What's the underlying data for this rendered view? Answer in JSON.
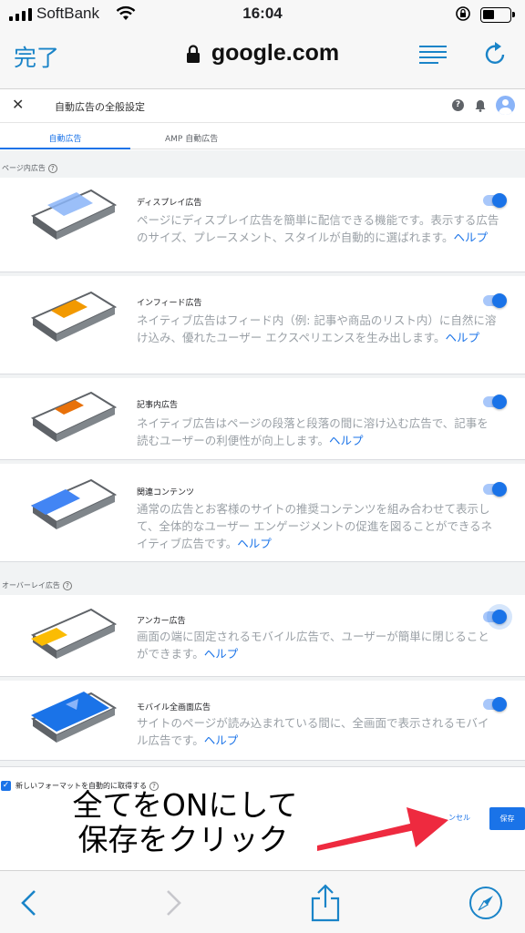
{
  "status_bar": {
    "carrier": "SoftBank",
    "time": "16:04"
  },
  "safari": {
    "done_label": "完了",
    "url": "google.com"
  },
  "header": {
    "title": "自動広告の全般設定"
  },
  "tabs": [
    {
      "label": "自動広告",
      "active": true
    },
    {
      "label": "AMP 自動広告",
      "active": false
    }
  ],
  "sections": {
    "in_page": "ページ内広告",
    "overlay": "オーバーレイ広告"
  },
  "formats": [
    {
      "title": "ディスプレイ広告",
      "description": "ページにディスプレイ広告を簡単に配信できる機能です。表示する広告のサイズ、プレースメント、スタイルが自動的に選ばれます。",
      "help": "ヘルプ",
      "enabled": true,
      "illustration_color": "#8ab4f8"
    },
    {
      "title": "インフィード広告",
      "description": "ネイティブ広告はフィード内（例: 記事や商品のリスト内）に自然に溶け込み、優れたユーザー エクスペリエンスを生み出します。",
      "help": "ヘルプ",
      "enabled": true,
      "illustration_color": "#f29900"
    },
    {
      "title": "記事内広告",
      "description": "ネイティブ広告はページの段落と段落の間に溶け込む広告で、記事を読むユーザーの利便性が向上します。",
      "help": "ヘルプ",
      "enabled": true,
      "illustration_color": "#e8710a"
    },
    {
      "title": "関連コンテンツ",
      "description": "通常の広告とお客様のサイトの推奨コンテンツを組み合わせて表示して、全体的なユーザー エンゲージメントの促進を図ることができるネイティブ広告です。",
      "help": "ヘルプ",
      "enabled": true,
      "illustration_color": "#4285f4"
    },
    {
      "title": "アンカー広告",
      "description": "画面の端に固定されるモバイル広告で、ユーザーが簡単に閉じることができます。",
      "help": "ヘルプ",
      "enabled": true,
      "illustration_color": "#fbbc04"
    },
    {
      "title": "モバイル全画面広告",
      "description": "サイトのページが読み込まれている間に、全画面で表示されるモバイル広告です。",
      "help": "ヘルプ",
      "enabled": true,
      "illustration_color": "#1a73e8"
    }
  ],
  "footer": {
    "auto_formats_label": "新しいフォーマットを自動的に取得する",
    "auto_formats_checked": true,
    "cancel_label": "ンセル",
    "save_label": "保存"
  },
  "annotation": {
    "line1": "全てをONにして",
    "line2": "保存をクリック",
    "arrow_color": "#ee2a3f"
  },
  "colors": {
    "accent": "#1a73e8",
    "safari_blue": "#1a84c8"
  }
}
